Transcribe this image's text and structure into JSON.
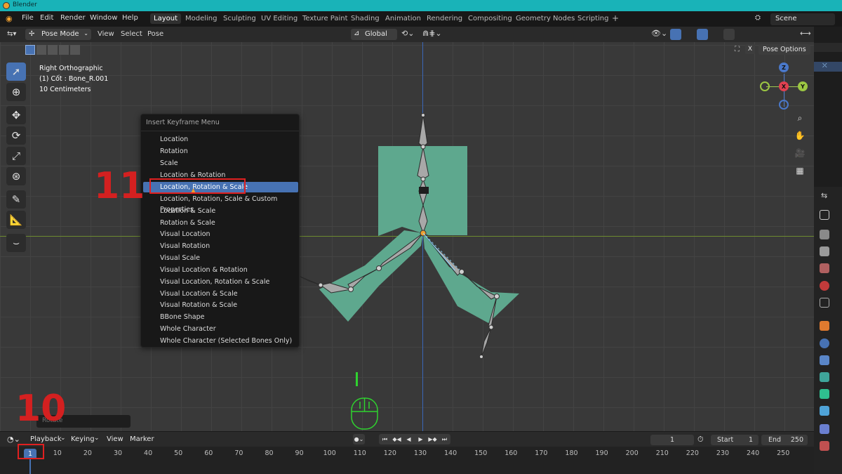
{
  "app": {
    "title": "Blender"
  },
  "menu": {
    "items": [
      "File",
      "Edit",
      "Render",
      "Window",
      "Help"
    ]
  },
  "workspaces": {
    "active": "Layout",
    "tabs": [
      "Layout",
      "Modeling",
      "Sculpting",
      "UV Editing",
      "Texture Paint",
      "Shading",
      "Animation",
      "Rendering",
      "Compositing",
      "Geometry Nodes",
      "Scripting"
    ],
    "add": "+"
  },
  "scene": {
    "label": "Scene"
  },
  "header": {
    "mode": "Pose Mode",
    "view": "View",
    "select": "Select",
    "pose": "Pose",
    "orientation": "Global",
    "pose_options": "Pose Options",
    "x_label": "X"
  },
  "viewport": {
    "view_name": "Right Orthographic",
    "object_info": "(1) Cốt : Bone_R.001",
    "scale_info": "10 Centimeters"
  },
  "gizmo": {
    "z": "Z",
    "x": "X",
    "y": "Y"
  },
  "keyframe_menu": {
    "title": "Insert Keyframe Menu",
    "items": [
      "Location",
      "Rotation",
      "Scale",
      "Location & Rotation",
      "Location, Rotation & Scale",
      "Location, Rotation, Scale & Custom Properties",
      "Location & Scale",
      "Rotation & Scale",
      "Visual Location",
      "Visual Rotation",
      "Visual Scale",
      "Visual Location & Rotation",
      "Visual Location, Rotation & Scale",
      "Visual Location & Scale",
      "Visual Rotation & Scale",
      "BBone Shape",
      "Whole Character",
      "Whole Character (Selected Bones Only)"
    ],
    "selected_index": 4
  },
  "annotations": {
    "step_11": "11",
    "step_10": "10"
  },
  "status": {
    "operator": "Rotate"
  },
  "timeline": {
    "playback": "Playback",
    "keying": "Keying",
    "view": "View",
    "marker": "Marker",
    "current_frame": "1",
    "start_label": "Start",
    "start": "1",
    "end_label": "End",
    "end": "250",
    "ticks": [
      "10",
      "20",
      "30",
      "40",
      "50",
      "60",
      "70",
      "80",
      "90",
      "100",
      "110",
      "120",
      "130",
      "140",
      "150",
      "160",
      "170",
      "180",
      "190",
      "200",
      "210",
      "220",
      "230",
      "240",
      "250"
    ],
    "frame_badge": "1"
  },
  "colors": {
    "accent": "#4772b3",
    "mesh": "#5ea88e",
    "annotation": "#e02020",
    "titlebar": "#19b3b8"
  }
}
